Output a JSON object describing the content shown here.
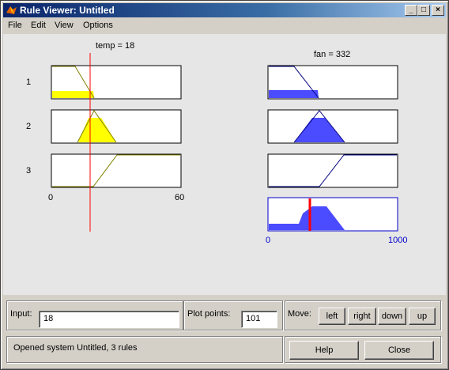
{
  "window": {
    "title": "Rule Viewer: Untitled"
  },
  "menu": [
    "File",
    "Edit",
    "View",
    "Options"
  ],
  "inputs": [
    {
      "label": "temp = 18",
      "range": [
        0,
        60
      ],
      "tick_labels": [
        "0",
        "60"
      ],
      "value": 18
    }
  ],
  "outputs": [
    {
      "label": "fan = 332",
      "range": [
        0,
        1000
      ],
      "tick_labels": [
        "0",
        "1000"
      ],
      "value": 332
    }
  ],
  "rules": [
    {
      "number": "1"
    },
    {
      "number": "2"
    },
    {
      "number": "3"
    }
  ],
  "bottom": {
    "input_label": "Input:",
    "input_value": "18",
    "plot_points_label": "Plot points:",
    "plot_points_value": "101",
    "move_label": "Move:",
    "move_buttons": {
      "left": "left",
      "right": "right",
      "down": "down",
      "up": "up"
    },
    "status": "Opened system Untitled, 3 rules",
    "help": "Help",
    "close": "Close"
  },
  "colors": {
    "input_fill": "#ffff00",
    "output_fill": "#4b4bff",
    "index_line": "#ff0000",
    "output_axis": "#0000cc"
  }
}
